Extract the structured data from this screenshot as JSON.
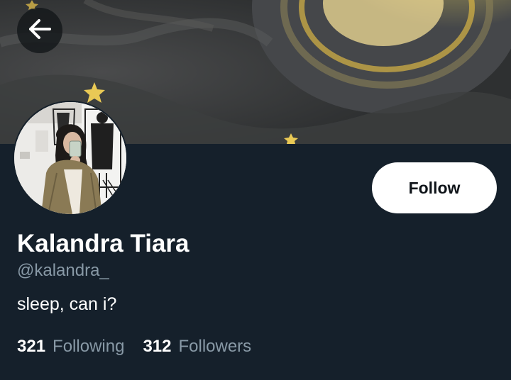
{
  "profile": {
    "display_name": "Kalandra Tiara",
    "handle": "@kalandra_",
    "bio": "sleep, can i?",
    "following_count": "321",
    "following_label": "Following",
    "followers_count": "312",
    "followers_label": "Followers"
  },
  "actions": {
    "follow_label": "Follow"
  },
  "icons": {
    "back": "arrow-left-icon"
  },
  "colors": {
    "background": "#15202b",
    "secondary_text": "#8899a6",
    "primary_text": "#ffffff",
    "follow_button_bg": "#ffffff",
    "follow_button_text": "#0f1419"
  }
}
